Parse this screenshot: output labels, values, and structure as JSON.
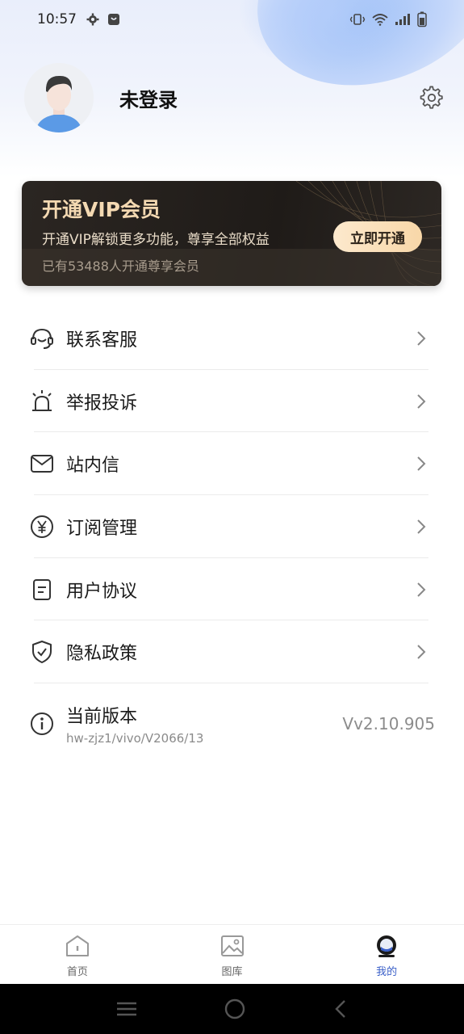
{
  "status_bar": {
    "time": "10:57"
  },
  "profile": {
    "username": "未登录"
  },
  "vip": {
    "title": "开通VIP会员",
    "subtitle": "开通VIP解锁更多功能，尊享全部权益",
    "count_text": "已有53488人开通尊享会员",
    "button_label": "立即开通"
  },
  "menu": {
    "items": [
      {
        "label": "联系客服",
        "icon": "headset-icon"
      },
      {
        "label": "举报投诉",
        "icon": "alarm-icon"
      },
      {
        "label": "站内信",
        "icon": "mail-icon"
      },
      {
        "label": "订阅管理",
        "icon": "yen-icon"
      },
      {
        "label": "用户协议",
        "icon": "document-icon"
      },
      {
        "label": "隐私政策",
        "icon": "shield-icon"
      }
    ],
    "version": {
      "label": "当前版本",
      "sub": "hw-zjz1/vivo/V2066/13",
      "value": "Vv2.10.905"
    }
  },
  "tabbar": {
    "tabs": [
      {
        "label": "首页",
        "icon": "home-icon",
        "active": false
      },
      {
        "label": "图库",
        "icon": "gallery-icon",
        "active": false
      },
      {
        "label": "我的",
        "icon": "profile-icon",
        "active": true
      }
    ]
  },
  "colors": {
    "accent": "#3a5fc8",
    "vip_gold": "#f4d9b2",
    "vip_bg": "#1f1b18"
  }
}
